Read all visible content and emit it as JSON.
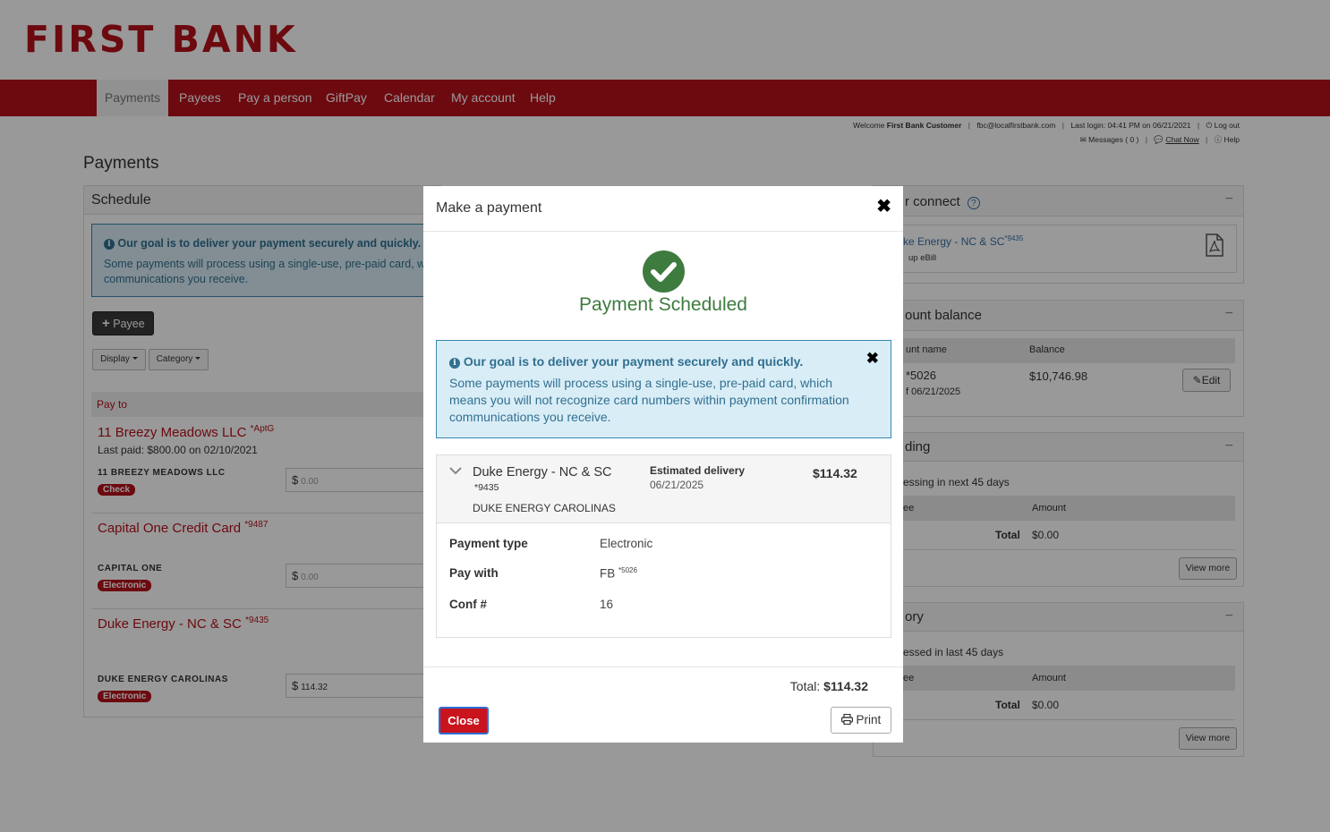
{
  "brand": {
    "name": "FIRST BANK",
    "color": "#b5121b"
  },
  "nav": [
    {
      "label": "Payments",
      "active": true
    },
    {
      "label": "Payees"
    },
    {
      "label": "Pay a person"
    },
    {
      "label": "GiftPay"
    },
    {
      "label": "Calendar"
    },
    {
      "label": "My account"
    },
    {
      "label": "Help"
    }
  ],
  "utility": {
    "welcome_prefix": "Welcome",
    "customer": "First Bank Customer",
    "email": "fbc@localfirstbank.com",
    "last_login": "Last login: 04:41 PM on 06/21/2021",
    "logout": "Log out",
    "messages": "Messages ( 0 )",
    "chat": "Chat Now",
    "help": "Help"
  },
  "page_title": "Payments",
  "schedule": {
    "title": "Schedule",
    "info_title": "Our goal is to deliver your payment securely and quickly.",
    "info_body": "Some payments will process using a single-use, pre-paid card, w communications you receive.",
    "add_payee": "Payee",
    "display": "Display",
    "category": "Category",
    "pay_to": "Pay to",
    "payees": [
      {
        "name": "11 Breezy Meadows LLC",
        "acct": "*AptG",
        "last_paid": "Last paid: $800.00 on 02/10/2021",
        "caps": "11 BREEZY MEADOWS LLC",
        "method": "Check",
        "amount": "0.00"
      },
      {
        "name": "Capital One Credit Card",
        "acct": "*9487",
        "last_paid": "",
        "caps": "CAPITAL ONE",
        "method": "Electronic",
        "amount": "0.00"
      },
      {
        "name": "Duke Energy - NC & SC",
        "acct": "*9435",
        "last_paid": "",
        "caps": "DUKE ENERGY CAROLINAS",
        "method": "Electronic",
        "amount": "114.32"
      }
    ],
    "currency": "$"
  },
  "right": {
    "ebill": {
      "title": "r connect",
      "payee": "ke Energy - NC & SC",
      "acct": "*9435",
      "sub": "up eBill"
    },
    "balance": {
      "title": "ount balance",
      "col_name": "unt name",
      "col_balance": "Balance",
      "acct": "*5026",
      "asof": "f 06/21/2025",
      "amount": "$10,746.98",
      "edit": "Edit"
    },
    "pending": {
      "title": "ding",
      "sub": "essing in next 45 days",
      "col_payee": "ee",
      "col_amount": "Amount",
      "total_label": "Total",
      "total": "$0.00",
      "view_more": "View more"
    },
    "history": {
      "title": "ory",
      "sub": "essed in last 45 days",
      "col_payee": "ee",
      "col_amount": "Amount",
      "total_label": "Total",
      "total": "$0.00",
      "view_more": "View more"
    }
  },
  "modal": {
    "title": "Make a payment",
    "status": "Payment Scheduled",
    "status_color": "#3d7b3f",
    "info_title": "Our goal is to deliver your payment securely and quickly.",
    "info_body": "Some payments will process using a single-use, pre-paid card, which means you will not recognize card numbers within payment confirmation communications you receive.",
    "payee": "Duke Energy - NC & SC",
    "payee_acct": "*9435",
    "payee_caps": "DUKE ENERGY CAROLINAS",
    "delivery_label": "Estimated delivery",
    "delivery_date": "06/21/2025",
    "amount": "$114.32",
    "payment_type_label": "Payment type",
    "payment_type": "Electronic",
    "pay_with_label": "Pay with",
    "pay_with": "FB",
    "pay_with_acct": "*5026",
    "conf_label": "Conf #",
    "conf": "16",
    "total_label": "Total:",
    "total": "$114.32",
    "close": "Close",
    "print": "Print"
  }
}
